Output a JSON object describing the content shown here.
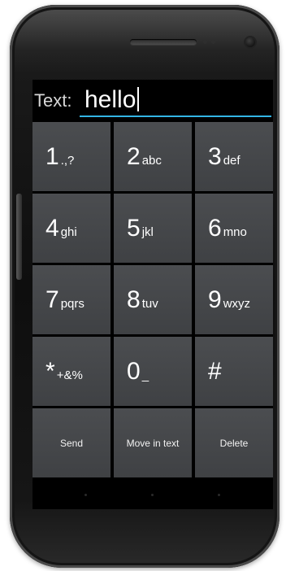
{
  "input": {
    "label": "Text:",
    "value": "hello"
  },
  "keys": [
    {
      "main": "1",
      "sub": ".,?"
    },
    {
      "main": "2",
      "sub": "abc"
    },
    {
      "main": "3",
      "sub": "def"
    },
    {
      "main": "4",
      "sub": "ghi"
    },
    {
      "main": "5",
      "sub": "jkl"
    },
    {
      "main": "6",
      "sub": "mno"
    },
    {
      "main": "7",
      "sub": "pqrs"
    },
    {
      "main": "8",
      "sub": "tuv"
    },
    {
      "main": "9",
      "sub": "wxyz"
    },
    {
      "main": "*",
      "sub": "+&%"
    },
    {
      "main": "0",
      "sub": "_"
    },
    {
      "main": "#",
      "sub": ""
    }
  ],
  "actions": {
    "send": "Send",
    "move": "Move in text",
    "delete": "Delete"
  },
  "colors": {
    "key_background": "#45474a",
    "accent_underline": "#33b5e5",
    "screen_background": "#000000"
  }
}
